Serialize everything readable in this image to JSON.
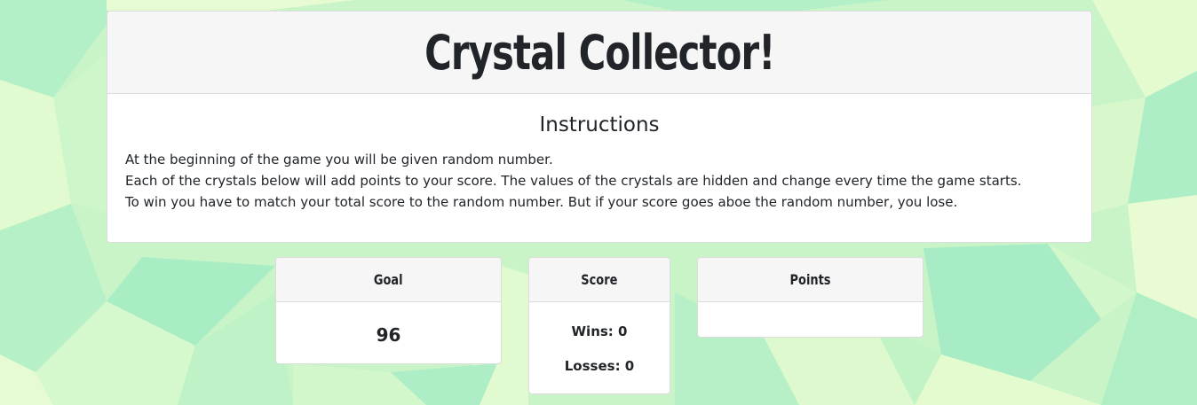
{
  "header": {
    "title": "Crystal Collector!"
  },
  "instructions": {
    "heading": "Instructions",
    "lines": [
      "At the beginning of the game you will be given random number.",
      "Each of the crystals below will add points to your score. The values of the crystals are hidden and change every time the game starts.",
      "To win you have to match your total score to the random number. But if your score goes aboe the random number, you lose."
    ]
  },
  "goal": {
    "label": "Goal",
    "value": "96"
  },
  "score": {
    "label": "Score",
    "wins": "Wins: 0",
    "losses": "Losses: 0"
  },
  "points": {
    "label": "Points",
    "value": ""
  },
  "colors": {
    "bg_light": "#e6fbd1",
    "bg_mid": "#c2f2c6",
    "bg_dark": "#a6efc5"
  }
}
